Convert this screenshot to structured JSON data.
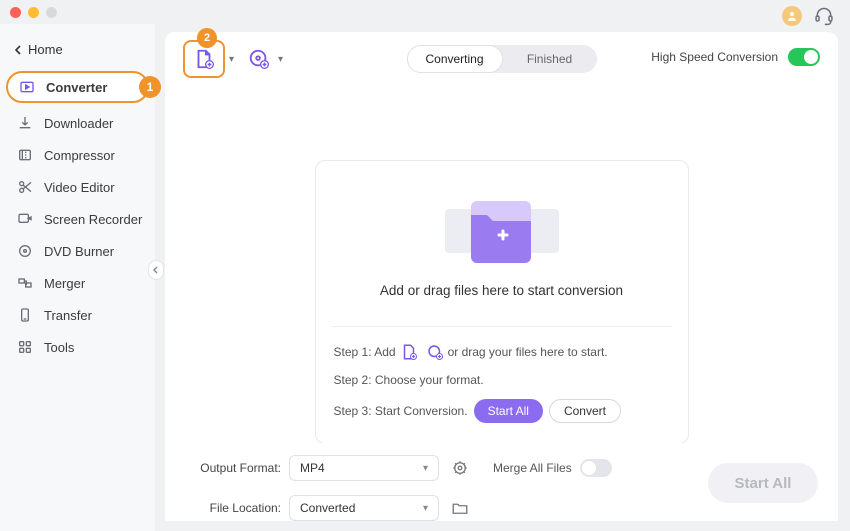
{
  "window": {
    "close": "close",
    "min": "minimize",
    "zoom": "zoom"
  },
  "top": {
    "avatar": "avatar",
    "support": "support"
  },
  "nav": {
    "home": "Home",
    "items": [
      {
        "label": "Converter"
      },
      {
        "label": "Downloader"
      },
      {
        "label": "Compressor"
      },
      {
        "label": "Video Editor"
      },
      {
        "label": "Screen Recorder"
      },
      {
        "label": "DVD Burner"
      },
      {
        "label": "Merger"
      },
      {
        "label": "Transfer"
      },
      {
        "label": "Tools"
      }
    ]
  },
  "callouts": {
    "one": "1",
    "two": "2"
  },
  "toolbar": {
    "segmented": {
      "converting": "Converting",
      "finished": "Finished"
    },
    "hsc_label": "High Speed Conversion",
    "hsc_on": true
  },
  "dropzone": {
    "main_text": "Add or drag files here to start conversion",
    "step1_prefix": "Step 1: Add",
    "step1_suffix": "or drag your files here to start.",
    "step2": "Step 2: Choose your format.",
    "step3": "Step 3: Start Conversion.",
    "start_all": "Start  All",
    "convert": "Convert"
  },
  "bottom": {
    "output_format_label": "Output Format:",
    "output_format_value": "MP4",
    "file_location_label": "File Location:",
    "file_location_value": "Converted",
    "merge_label": "Merge All Files",
    "merge_on": false,
    "start_all_btn": "Start All"
  }
}
